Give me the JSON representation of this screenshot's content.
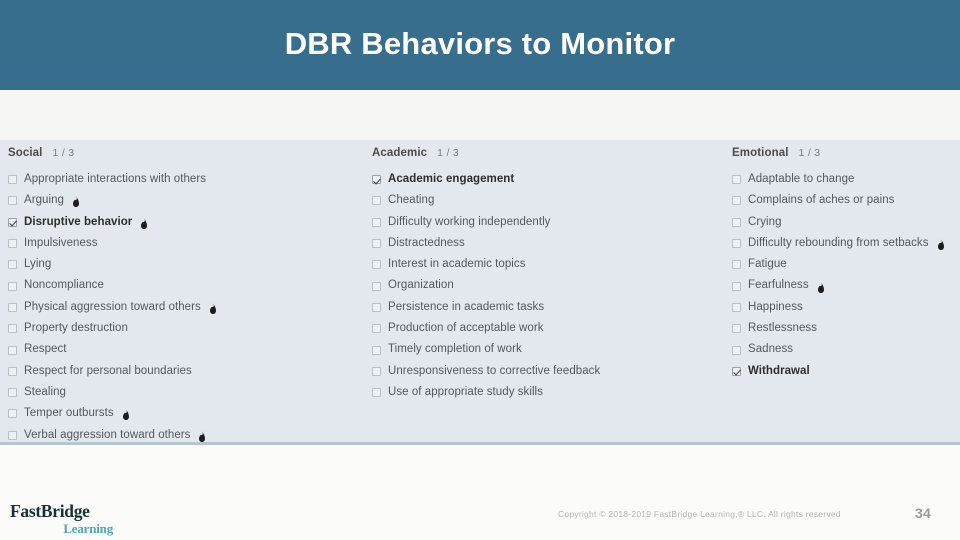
{
  "header": {
    "title": "DBR Behaviors to Monitor",
    "background_color": "#376e8e",
    "title_color": "#ffffff"
  },
  "panel": {
    "background_color": "#e3e8ee",
    "border_color": "#b7c4d1"
  },
  "columns": [
    {
      "key": "social",
      "title": "Social",
      "count": "1 / 3",
      "items": [
        {
          "label": "Appropriate interactions with others",
          "checked": false,
          "flame": false
        },
        {
          "label": "Arguing",
          "checked": false,
          "flame": true
        },
        {
          "label": "Disruptive behavior",
          "checked": true,
          "flame": true
        },
        {
          "label": "Impulsiveness",
          "checked": false,
          "flame": false
        },
        {
          "label": "Lying",
          "checked": false,
          "flame": false
        },
        {
          "label": "Noncompliance",
          "checked": false,
          "flame": false
        },
        {
          "label": "Physical aggression toward others",
          "checked": false,
          "flame": true
        },
        {
          "label": "Property destruction",
          "checked": false,
          "flame": false
        },
        {
          "label": "Respect",
          "checked": false,
          "flame": false
        },
        {
          "label": "Respect for personal boundaries",
          "checked": false,
          "flame": false
        },
        {
          "label": "Stealing",
          "checked": false,
          "flame": false
        },
        {
          "label": "Temper outbursts",
          "checked": false,
          "flame": true
        },
        {
          "label": "Verbal aggression toward others",
          "checked": false,
          "flame": true
        }
      ]
    },
    {
      "key": "academic",
      "title": "Academic",
      "count": "1 / 3",
      "items": [
        {
          "label": "Academic engagement",
          "checked": true,
          "flame": false
        },
        {
          "label": "Cheating",
          "checked": false,
          "flame": false
        },
        {
          "label": "Difficulty working independently",
          "checked": false,
          "flame": false
        },
        {
          "label": "Distractedness",
          "checked": false,
          "flame": false
        },
        {
          "label": "Interest in academic topics",
          "checked": false,
          "flame": false
        },
        {
          "label": "Organization",
          "checked": false,
          "flame": false
        },
        {
          "label": "Persistence in academic tasks",
          "checked": false,
          "flame": false
        },
        {
          "label": "Production of acceptable work",
          "checked": false,
          "flame": false
        },
        {
          "label": "Timely completion of work",
          "checked": false,
          "flame": false
        },
        {
          "label": "Unresponsiveness to corrective feedback",
          "checked": false,
          "flame": false
        },
        {
          "label": "Use of appropriate study skills",
          "checked": false,
          "flame": false
        }
      ]
    },
    {
      "key": "emotional",
      "title": "Emotional",
      "count": "1 / 3",
      "items": [
        {
          "label": "Adaptable to change",
          "checked": false,
          "flame": false
        },
        {
          "label": "Complains of aches or pains",
          "checked": false,
          "flame": false
        },
        {
          "label": "Crying",
          "checked": false,
          "flame": false
        },
        {
          "label": "Difficulty rebounding from setbacks",
          "checked": false,
          "flame": true
        },
        {
          "label": "Fatigue",
          "checked": false,
          "flame": false
        },
        {
          "label": "Fearfulness",
          "checked": false,
          "flame": true
        },
        {
          "label": "Happiness",
          "checked": false,
          "flame": false
        },
        {
          "label": "Restlessness",
          "checked": false,
          "flame": false
        },
        {
          "label": "Sadness",
          "checked": false,
          "flame": false
        },
        {
          "label": "Withdrawal",
          "checked": true,
          "flame": false
        }
      ]
    }
  ],
  "footer": {
    "logo_top": "FastBridge",
    "logo_bottom": "Learning",
    "logo_top_color": "#16303c",
    "logo_bottom_color": "#4aa7b4",
    "copyright": "Copyright © 2018-2019 FastBridge Learning,® LLC. All rights reserved",
    "page_number": "34"
  }
}
